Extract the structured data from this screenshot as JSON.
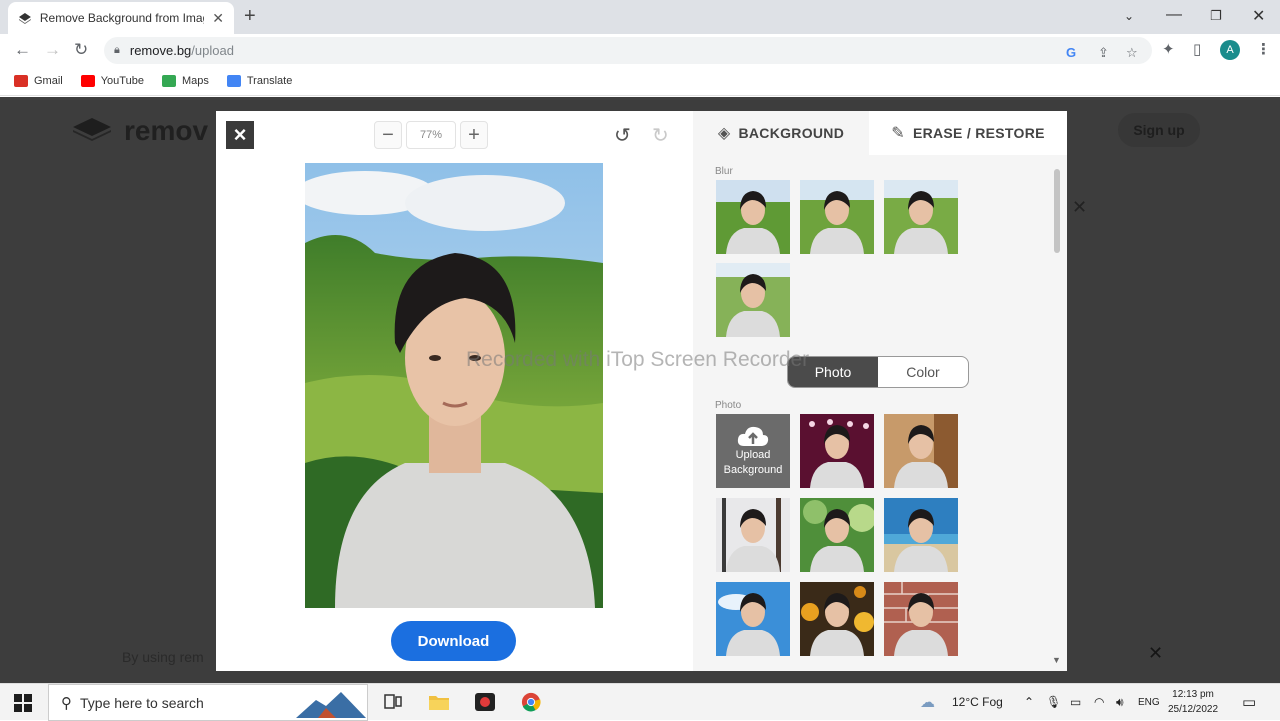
{
  "browser": {
    "tab_title": "Remove Background from Imag",
    "url_host": "remove.bg",
    "url_path": "/upload",
    "profile_initial": "A",
    "bookmarks": [
      {
        "label": "Gmail",
        "icon": "gmail-icon",
        "color": "#d93025"
      },
      {
        "label": "YouTube",
        "icon": "youtube-icon",
        "color": "#ff0000"
      },
      {
        "label": "Maps",
        "icon": "maps-icon",
        "color": "#34a853"
      },
      {
        "label": "Translate",
        "icon": "translate-icon",
        "color": "#4285f4"
      }
    ]
  },
  "page": {
    "logo_text": "remov",
    "signup_label": "Sign up",
    "cookie_text": "By using rem"
  },
  "editor": {
    "zoom_value": "77%",
    "download_label": "Download",
    "watermark": "Recorded with iTop Screen Recorder",
    "tabs": {
      "background": "BACKGROUND",
      "erase_restore": "ERASE / RESTORE"
    },
    "blur_label": "Blur",
    "photo_label": "Photo",
    "toggle": {
      "photo": "Photo",
      "color": "Color",
      "selected": "Photo"
    },
    "upload_tile": {
      "line1": "Upload",
      "line2": "Background"
    },
    "colors": {
      "download": "#1b6fe0",
      "toggle_on": "#4b4b4b"
    }
  },
  "taskbar": {
    "search_placeholder": "Type here to search",
    "weather": "12°C  Fog",
    "language": "ENG",
    "time": "12:13 pm",
    "date": "25/12/2022"
  }
}
